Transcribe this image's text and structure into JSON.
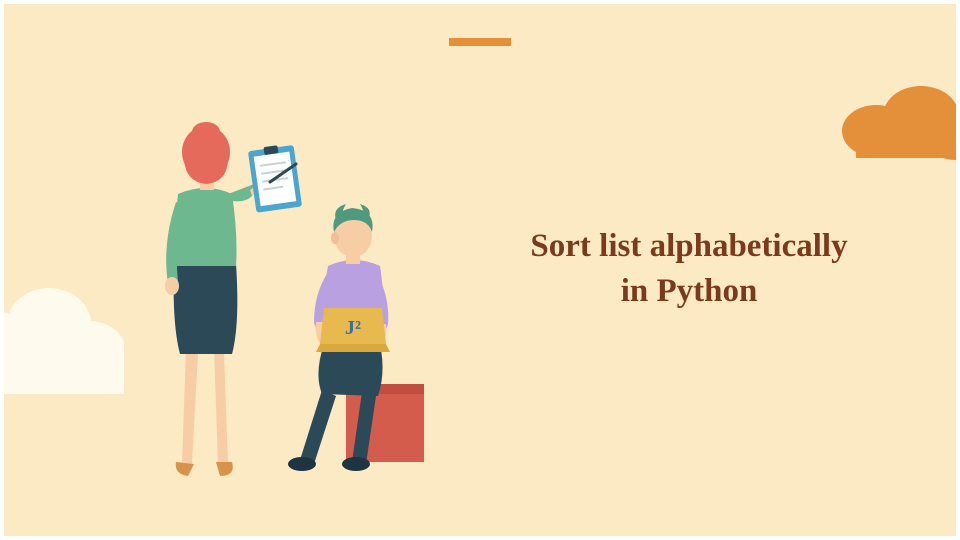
{
  "title_line1": "Sort list alphabetically",
  "title_line2": "in Python",
  "colors": {
    "background": "#fbeac3",
    "accent_bar": "#e4903a",
    "title_text": "#7a3a1d",
    "cloud_right": "#e4903a",
    "cloud_left": "#fefbee",
    "woman_hair": "#e56a5b",
    "woman_shirt": "#6db88e",
    "woman_skirt": "#2b4957",
    "woman_skin": "#f7cda6",
    "woman_shoes": "#d7934a",
    "clipboard_border": "#4aa6cf",
    "clipboard_paper": "#ffffff",
    "pen": "#2b4957",
    "man_hair": "#4f9a7c",
    "man_shirt": "#b9a0e0",
    "man_pants": "#2b4957",
    "man_skin": "#f7cda6",
    "man_shoes": "#1e3440",
    "stool": "#d45c4d",
    "laptop": "#e8b94f",
    "laptop_logo": "#3a6ea5"
  },
  "laptop_logo_text": "J²"
}
